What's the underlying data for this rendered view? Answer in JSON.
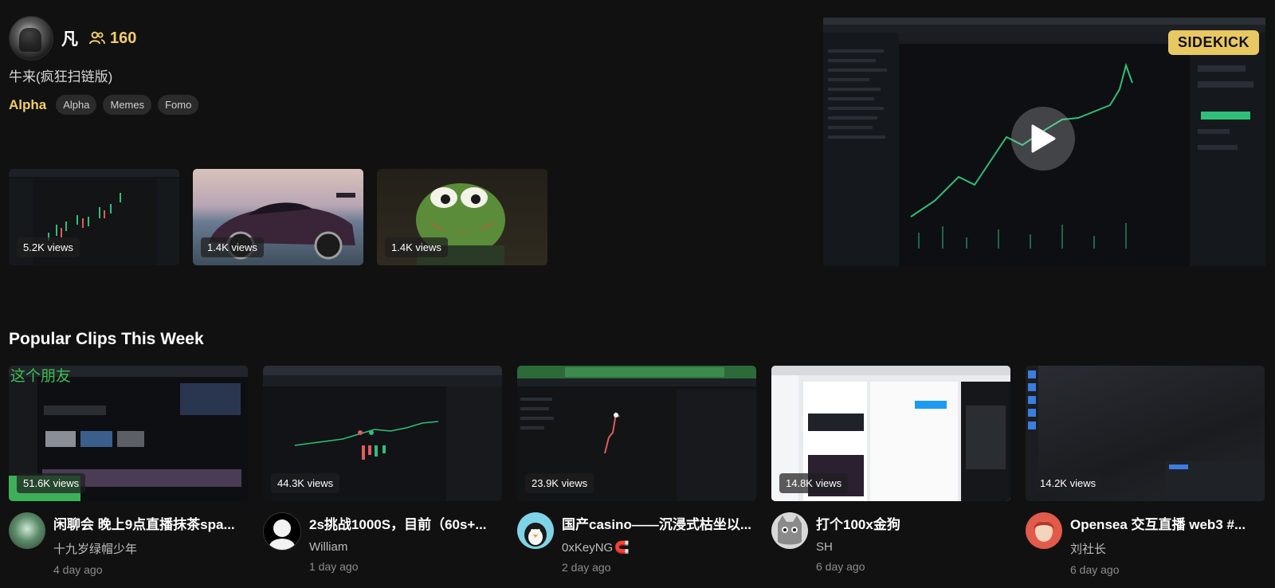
{
  "profile": {
    "name": "凡",
    "followers": "160",
    "bio": "牛来(疯狂扫链版)",
    "highlight_tag": "Alpha",
    "tags": [
      "Alpha",
      "Memes",
      "Fomo"
    ]
  },
  "recent_videos": [
    {
      "views": "5.2K views",
      "thumb": "trading-chart"
    },
    {
      "views": "1.4K views",
      "thumb": "sports-car"
    },
    {
      "views": "1.4K views",
      "thumb": "pepe-frog"
    }
  ],
  "featured": {
    "badge": "SIDEKICK",
    "icon": "play-icon"
  },
  "popular": {
    "section_title": "Popular Clips This Week",
    "clips": [
      {
        "title": "闲聊会 晚上9点直播抹茶spa...",
        "author": "十九岁绿帽少年",
        "date": "4 day ago",
        "views": "51.6K views",
        "overlay": "这个朋友"
      },
      {
        "title": "2s挑战1000S，目前（60s+...",
        "author": "William",
        "date": "1 day ago",
        "views": "44.3K views"
      },
      {
        "title": "国产casino——沉浸式枯坐以...",
        "author": "0xKeyNG",
        "author_icon": "🧲",
        "date": "2 day ago",
        "views": "23.9K views"
      },
      {
        "title": "打个100x金狗",
        "author": "SH",
        "date": "6 day ago",
        "views": "14.8K views"
      },
      {
        "title": "Opensea 交互直播 web3 #...",
        "author": "刘社长",
        "date": "6 day ago",
        "views": "14.2K views"
      }
    ]
  },
  "colors": {
    "background": "#111111",
    "accent": "#f2cd6a",
    "tag_bg": "#2b2b2b",
    "sidekick_badge": "#e8c862"
  }
}
